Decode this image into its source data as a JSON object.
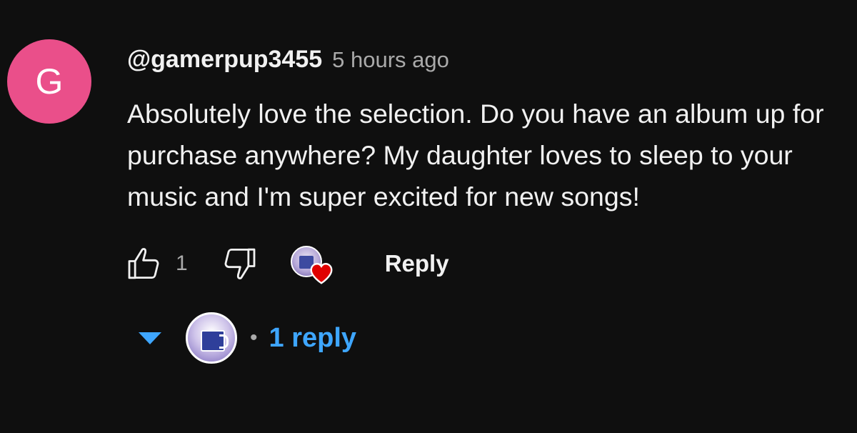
{
  "comment": {
    "avatar_letter": "G",
    "avatar_color": "#ea4f8a",
    "author": "@gamerpup3455",
    "timestamp": "5 hours ago",
    "text": "Absolutely love the selection. Do you have an album up for purchase anywhere? My daughter loves to sleep to your music and I'm super excited for new songs!"
  },
  "actions": {
    "like_icon": "thumbs-up-icon",
    "like_count": "1",
    "dislike_icon": "thumbs-down-icon",
    "creator_heart_icon": "creator-heart-icon",
    "heart_color": "#e00000",
    "reply_label": "Reply"
  },
  "replies": {
    "toggle_icon": "caret-down-icon",
    "separator": "•",
    "count_label": "1 reply",
    "link_color": "#3ea6ff"
  }
}
